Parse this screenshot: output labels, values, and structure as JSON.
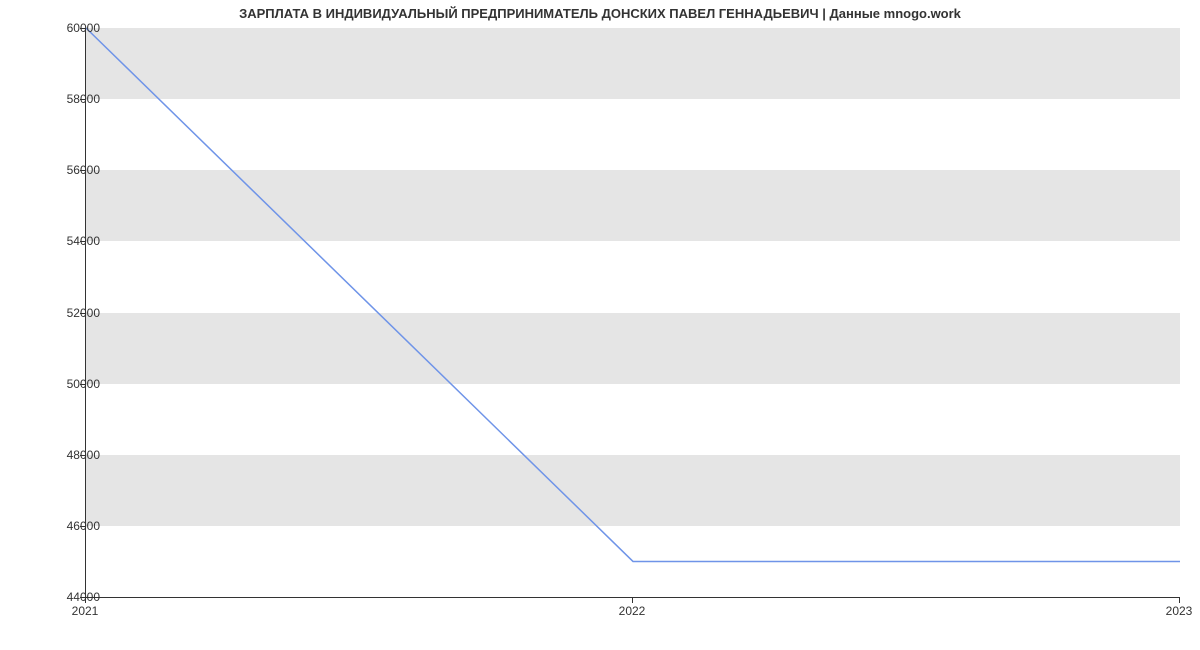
{
  "chart_data": {
    "type": "line",
    "title": "ЗАРПЛАТА В ИНДИВИДУАЛЬНЫЙ ПРЕДПРИНИМАТЕЛЬ ДОНСКИХ ПАВЕЛ ГЕННАДЬЕВИЧ | Данные mnogo.work",
    "x": [
      2021,
      2022,
      2023
    ],
    "values": [
      60000,
      45000,
      45000
    ],
    "xlabel": "",
    "ylabel": "",
    "xlim": [
      2021,
      2023
    ],
    "ylim": [
      44000,
      60000
    ],
    "y_ticks": [
      44000,
      46000,
      48000,
      50000,
      52000,
      54000,
      56000,
      58000,
      60000
    ],
    "x_ticks": [
      2021,
      2022,
      2023
    ],
    "line_color": "#6f94e8"
  }
}
